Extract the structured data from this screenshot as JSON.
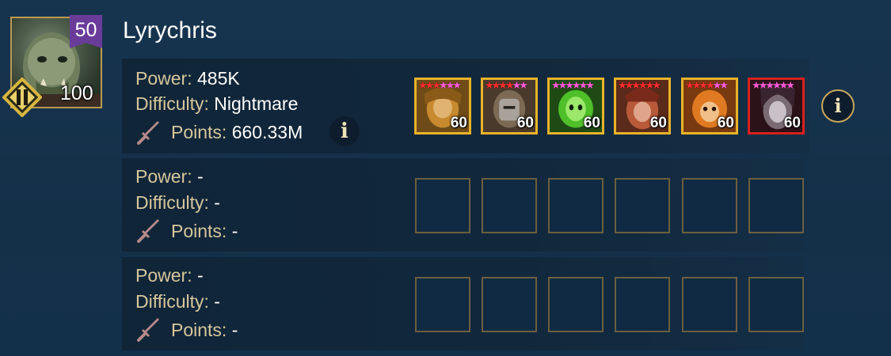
{
  "player": {
    "name": "Lyrychris",
    "level": "50",
    "avatar_count": "100"
  },
  "teams": [
    {
      "power_label": "Power: ",
      "power": "485K",
      "difficulty_label": "Difficulty: ",
      "difficulty": "Nightmare",
      "points_label": "Points: ",
      "points": "660.33M",
      "champions": [
        {
          "level": "60",
          "border": "#e8b32a"
        },
        {
          "level": "60",
          "border": "#e8b32a"
        },
        {
          "level": "60",
          "border": "#e8b32a"
        },
        {
          "level": "60",
          "border": "#e8b32a"
        },
        {
          "level": "60",
          "border": "#e8b32a"
        },
        {
          "level": "60",
          "border": "#d8201d"
        }
      ]
    },
    {
      "power_label": "Power: ",
      "power": "-",
      "difficulty_label": "Difficulty: ",
      "difficulty": "-",
      "points_label": "Points: ",
      "points": "-"
    },
    {
      "power_label": "Power: ",
      "power": "-",
      "difficulty_label": "Difficulty: ",
      "difficulty": "-",
      "points_label": "Points: ",
      "points": "-"
    }
  ],
  "info_glyph": "i",
  "icons": {
    "rank": "pause-diamond-icon",
    "points": "sword-icon",
    "info": "info-icon"
  },
  "colors": {
    "label": "#d6c79c",
    "value": "#ffffff",
    "slot_border_gold": "#e8b32a",
    "slot_border_red": "#d8201d",
    "level_badge": "#6a3c9a"
  }
}
